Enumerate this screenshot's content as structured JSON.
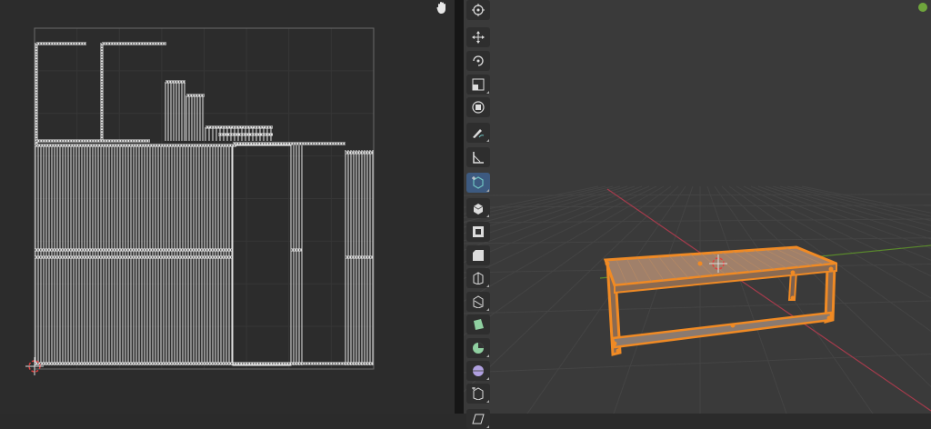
{
  "colors": {
    "uv_background": "#2c2c2c",
    "uv_grid": "#3a3a3a",
    "uv_wire": "#e6e6e6",
    "viewport_background": "#3a3a3a",
    "viewport_grid": "#454545",
    "axis_x": "#a53b4c",
    "axis_y": "#5a8a2c",
    "selection": "#f08a24",
    "selection_fill": "#a0806a",
    "active_tool": "#3d5a80",
    "gizmo_dot": "#6fa53c"
  },
  "uv_editor": {
    "hand_icon": "hand-icon",
    "cursor_icon": "2d-cursor-icon"
  },
  "toolbar": {
    "tools": [
      {
        "name": "cursor",
        "icon": "cursor-icon",
        "active": false,
        "has_submenu": false
      },
      {
        "name": "move",
        "icon": "move-icon",
        "active": false,
        "has_submenu": false
      },
      {
        "name": "rotate",
        "icon": "rotate-icon",
        "active": false,
        "has_submenu": false
      },
      {
        "name": "scale",
        "icon": "scale-icon",
        "active": false,
        "has_submenu": true
      },
      {
        "name": "transform",
        "icon": "transform-icon",
        "active": false,
        "has_submenu": false
      },
      {
        "name": "annotate",
        "icon": "annotate-icon",
        "active": false,
        "has_submenu": true
      },
      {
        "name": "measure",
        "icon": "measure-icon",
        "active": false,
        "has_submenu": false
      },
      {
        "name": "add-cube",
        "icon": "add-cube-icon",
        "active": true,
        "has_submenu": true
      },
      {
        "name": "extrude",
        "icon": "extrude-icon",
        "active": false,
        "has_submenu": true
      },
      {
        "name": "inset",
        "icon": "inset-icon",
        "active": false,
        "has_submenu": false
      },
      {
        "name": "bevel",
        "icon": "bevel-icon",
        "active": false,
        "has_submenu": false
      },
      {
        "name": "loop-cut",
        "icon": "loop-cut-icon",
        "active": false,
        "has_submenu": true
      },
      {
        "name": "knife",
        "icon": "knife-icon",
        "active": false,
        "has_submenu": true
      },
      {
        "name": "poly-build",
        "icon": "poly-build-icon",
        "active": false,
        "has_submenu": false
      },
      {
        "name": "spin",
        "icon": "spin-icon",
        "active": false,
        "has_submenu": true
      },
      {
        "name": "smooth",
        "icon": "smooth-icon",
        "active": false,
        "has_submenu": true
      },
      {
        "name": "shrink-fatten",
        "icon": "shrink-fatten-icon",
        "active": false,
        "has_submenu": true
      },
      {
        "name": "shear",
        "icon": "shear-icon",
        "active": false,
        "has_submenu": true
      }
    ]
  },
  "viewport": {
    "object": "table-mesh",
    "navigation_gizmo": "gizmo-dot"
  }
}
